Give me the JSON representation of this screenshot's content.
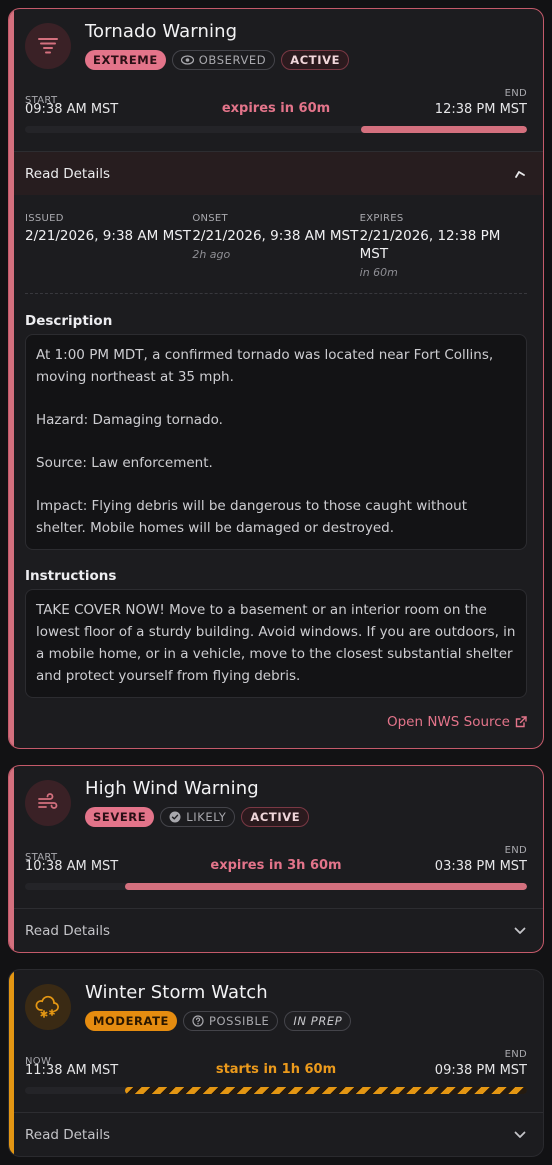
{
  "alerts": [
    {
      "icon": "tornado-icon",
      "title": "Tornado Warning",
      "severity": "EXTREME",
      "certainty": "OBSERVED",
      "status": "ACTIVE",
      "start_label": "START",
      "start_time": "09:38 AM MST",
      "countdown": "expires in 60m",
      "end_label": "END",
      "end_time": "12:38 PM MST",
      "remaining_fraction": 0.33,
      "details_label": "Read Details",
      "details_expanded": true,
      "issued_label": "ISSUED",
      "issued": "2/21/2026, 9:38 AM MST",
      "onset_label": "ONSET",
      "onset": "2/21/2026, 9:38 AM MST",
      "onset_relative": "2h ago",
      "expires_label": "EXPIRES",
      "expires": "2/21/2026, 12:38 PM MST",
      "expires_relative": "in 60m",
      "description_heading": "Description",
      "description": [
        "At 1:00 PM MDT, a confirmed tornado was located near Fort Collins, moving northeast at 35 mph.",
        "Hazard: Damaging tornado.",
        "Source: Law enforcement.",
        "Impact: Flying debris will be dangerous to those caught without shelter. Mobile homes will be damaged or destroyed."
      ],
      "instructions_heading": "Instructions",
      "instructions": "TAKE COVER NOW! Move to a basement or an interior room on the lowest floor of a sturdy building. Avoid windows. If you are outdoors, in a mobile home, or in a vehicle, move to the closest substantial shelter and protect yourself from flying debris.",
      "source_link": "Open NWS Source"
    },
    {
      "icon": "wind-icon",
      "title": "High Wind Warning",
      "severity": "SEVERE",
      "certainty": "LIKELY",
      "status": "ACTIVE",
      "start_label": "START",
      "start_time": "10:38 AM MST",
      "countdown": "expires in 3h 60m",
      "end_label": "END",
      "end_time": "03:38 PM MST",
      "remaining_fraction": 0.8,
      "details_label": "Read Details",
      "details_expanded": false
    },
    {
      "icon": "snow-cloud-icon",
      "title": "Winter Storm Watch",
      "severity": "MODERATE",
      "certainty": "POSSIBLE",
      "status": "IN PREP",
      "start_label": "NOW",
      "start_time": "11:38 AM MST",
      "countdown": "starts in 1h 60m",
      "end_label": "END",
      "end_time": "09:38 PM MST",
      "remaining_fraction": 0.8,
      "details_label": "Read Details",
      "details_expanded": false
    }
  ],
  "colors": {
    "extreme": "#e3748a",
    "moderate": "#e58c10",
    "card_bg": "#1c1c1f"
  }
}
